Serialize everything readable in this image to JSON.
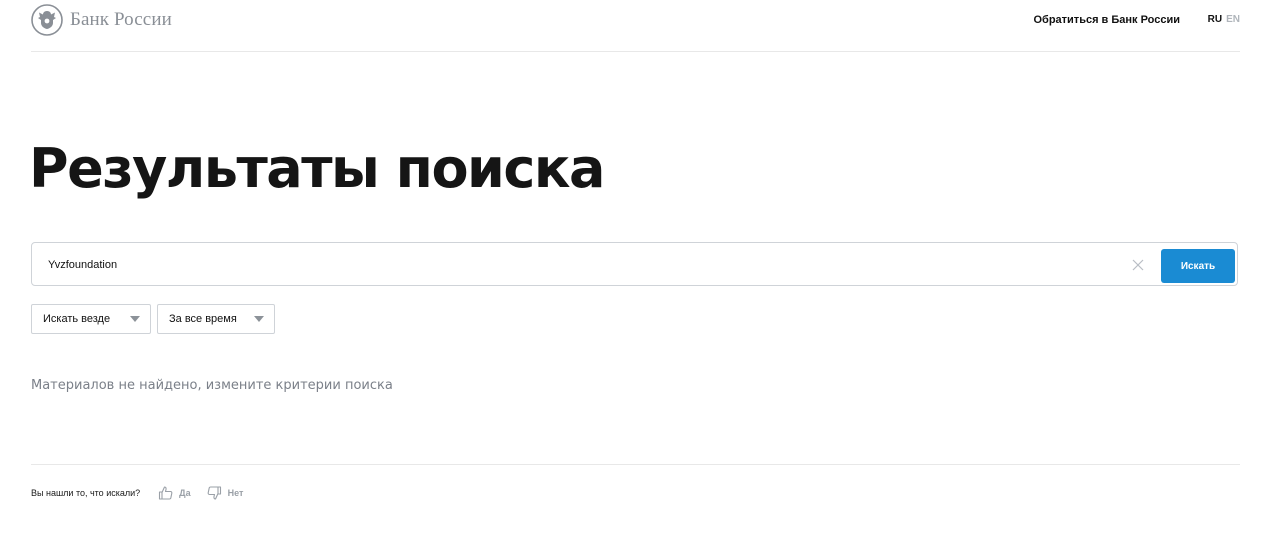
{
  "header": {
    "logo_text": "Банк России",
    "contact_link": "Обратиться в Банк России",
    "lang_ru": "RU",
    "lang_en": "EN"
  },
  "main": {
    "title": "Результаты поиска",
    "search": {
      "value": "Yvzfoundation",
      "button_label": "Искать"
    },
    "filters": {
      "where": "Искать везде",
      "period": "За все время"
    },
    "no_results": "Материалов не найдено, измените критерии поиска"
  },
  "feedback": {
    "question": "Вы нашли то, что искали?",
    "yes": "Да",
    "no": "Нет"
  },
  "colors": {
    "accent": "#1a8bd3",
    "muted_text": "#7b8089",
    "border": "#cfd3d8"
  },
  "icons": [
    "bank-emblem-icon",
    "clear-icon",
    "dropdown-arrow-icon",
    "thumbs-up-icon",
    "thumbs-down-icon"
  ]
}
